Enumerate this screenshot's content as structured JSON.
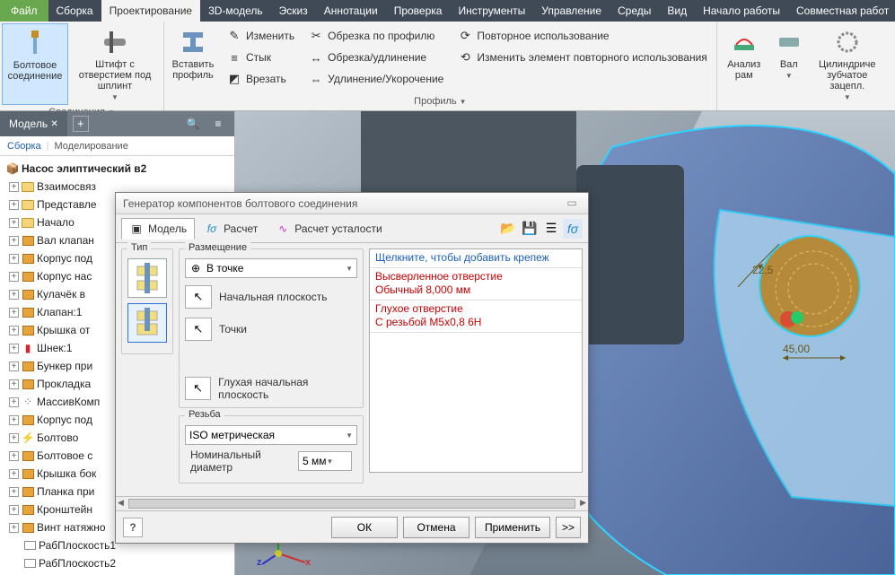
{
  "menu": {
    "file": "Файл",
    "items": [
      "Сборка",
      "Проектирование",
      "3D-модель",
      "Эскиз",
      "Аннотации",
      "Проверка",
      "Инструменты",
      "Управление",
      "Среды",
      "Вид",
      "Начало работы",
      "Совместная работ"
    ],
    "active_index": 1
  },
  "ribbon": {
    "g1": {
      "bolt": "Болтовое соединение",
      "pin": "Штифт с отверстием под шплинт",
      "label": "Соединения"
    },
    "g2": {
      "insert": "Вставить профиль",
      "modify": "Изменить",
      "butt": "Стык",
      "cut": "Врезать",
      "trim_profile": "Обрезка по профилю",
      "trim_ext": "Обрезка/удлинение",
      "ext_short": "Удлинение/Укорочение",
      "reuse": "Повторное использование",
      "mod_reuse": "Изменить элемент повторного использования",
      "label": "Профиль"
    },
    "g3": {
      "frame": "Анализ рам",
      "shaft": "Вал",
      "gear": "Цилиндриче\nзубчатое зацепл."
    }
  },
  "panel": {
    "tab": "Модель",
    "toggle_a": "Сборка",
    "toggle_b": "Моделирование",
    "root": "Насос элиптический в2",
    "nodes": [
      {
        "icon": "folder",
        "text": "Взаимосвяз"
      },
      {
        "icon": "folder",
        "text": "Представле"
      },
      {
        "icon": "folder",
        "text": "Начало"
      },
      {
        "icon": "box",
        "text": "Вал клапан"
      },
      {
        "icon": "box",
        "text": "Корпус под"
      },
      {
        "icon": "box",
        "text": "Корпус нас"
      },
      {
        "icon": "box",
        "text": "Кулачёк в"
      },
      {
        "icon": "box",
        "text": "Клапан:1"
      },
      {
        "icon": "box",
        "text": "Крышка от"
      },
      {
        "icon": "red",
        "text": "Шнек:1"
      },
      {
        "icon": "box",
        "text": "Бункер при"
      },
      {
        "icon": "box",
        "text": "Прокладка"
      },
      {
        "icon": "pat",
        "text": "МассивКомп"
      },
      {
        "icon": "box",
        "text": "Корпус под"
      },
      {
        "icon": "bolt",
        "text": "Болтово"
      },
      {
        "icon": "box",
        "text": "Болтовое с"
      },
      {
        "icon": "box",
        "text": "Крышка бок"
      },
      {
        "icon": "box",
        "text": "Планка при"
      },
      {
        "icon": "box",
        "text": "Кронштейн"
      },
      {
        "icon": "box",
        "text": "Винт натяжно"
      },
      {
        "icon": "plane",
        "text": "РабПлоскость1"
      },
      {
        "icon": "plane",
        "text": "РабПлоскость2"
      }
    ]
  },
  "viewport": {
    "dim1": "22,5",
    "dim2": "45,00",
    "axes": {
      "x": "x",
      "y": "y",
      "z": "z"
    }
  },
  "dialog": {
    "title": "Генератор компонентов болтового соединения",
    "tabs": {
      "model": "Модель",
      "calc": "Расчет",
      "fatigue": "Расчет усталости"
    },
    "type_label": "Тип",
    "placement": {
      "label": "Размещение",
      "mode": "В точке",
      "start_plane": "Начальная плоскость",
      "points": "Точки",
      "blind_plane": "Глухая начальная плоскость"
    },
    "thread": {
      "label": "Резьба",
      "standard": "ISO метрическая",
      "nominal_label": "Номинальный диаметр",
      "nominal_value": "5 мм"
    },
    "list": {
      "header": "Щелкните, чтобы добавить крепеж",
      "r1a": "Высверленное отверстие",
      "r1b": "Обычный 8,000 мм",
      "r2a": "Глухое отверстие",
      "r2b": "С резьбой M5x0,8 6H"
    },
    "buttons": {
      "ok": "ОК",
      "cancel": "Отмена",
      "apply": "Применить",
      "more": ">>",
      "help": "?"
    }
  }
}
